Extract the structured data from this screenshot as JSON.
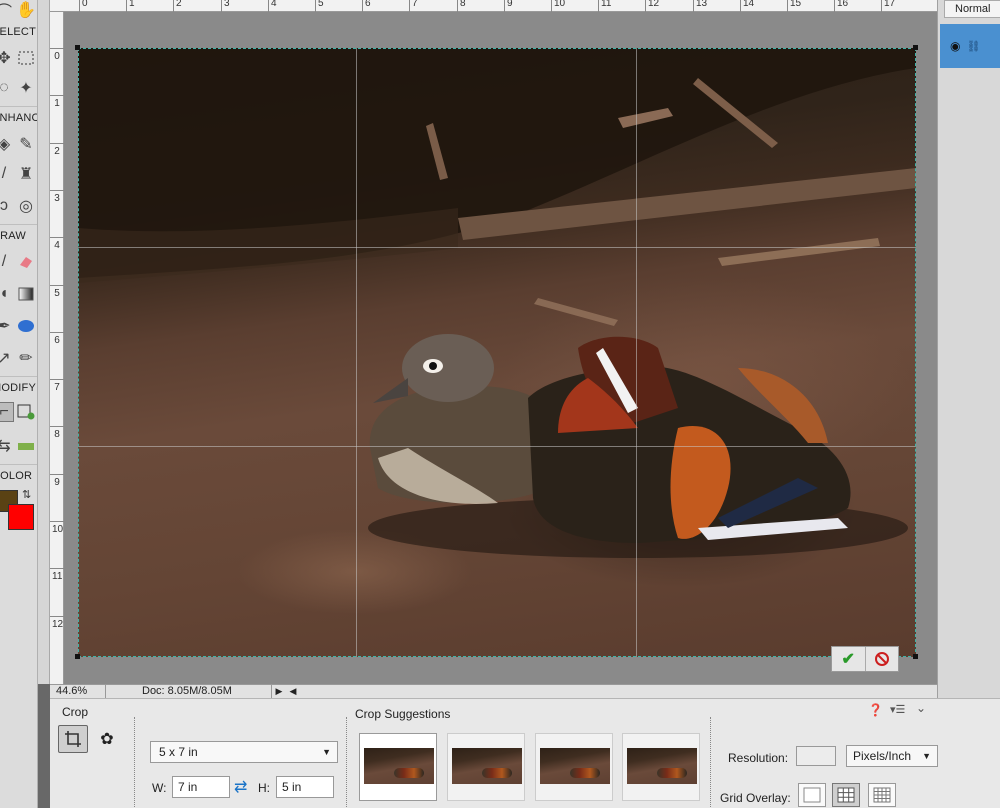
{
  "toolbox": {
    "sections": [
      "SELECT",
      "ENHANCE",
      "DRAW",
      "MODIFY",
      "COLOR"
    ],
    "foreground_color": "#5a4214",
    "background_color": "#ff0000"
  },
  "rulers": {
    "top": [
      "0",
      "1",
      "2",
      "3",
      "4",
      "5",
      "6",
      "7",
      "8",
      "9",
      "10",
      "11",
      "12",
      "13",
      "14",
      "15",
      "16",
      "17"
    ],
    "left": [
      "0",
      "1",
      "2",
      "3",
      "4",
      "5",
      "6",
      "7",
      "8",
      "9",
      "10",
      "11",
      "12"
    ]
  },
  "status_bar": {
    "zoom": "44.6%",
    "doc": "Doc: 8.05M/8.05M"
  },
  "layers_panel": {
    "blend_mode": "Normal"
  },
  "crop_commit": {
    "commit_icon": "checkmark-icon",
    "cancel_icon": "cancel-icon",
    "commit_color": "#2a9a2a",
    "cancel_color": "#cc1f1f"
  },
  "tool_options": {
    "title": "Crop",
    "preset": "5 x 7 in",
    "width_label": "W:",
    "width_value": "7 in",
    "height_label": "H:",
    "height_value": "5 in",
    "suggestions_title": "Crop Suggestions",
    "resolution_label": "Resolution:",
    "resolution_value": "",
    "resolution_unit": "Pixels/Inch",
    "grid_overlay_label": "Grid Overlay:"
  }
}
